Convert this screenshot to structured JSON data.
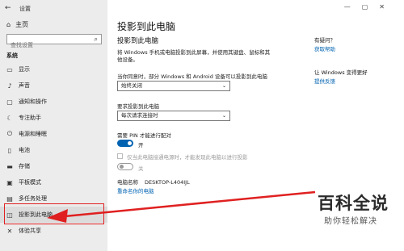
{
  "app": {
    "title": "设置"
  },
  "sidebar": {
    "home_label": "主页",
    "search_placeholder": "查找设置",
    "section_label": "系统",
    "items": [
      {
        "label": "显示",
        "icon": "monitor-icon"
      },
      {
        "label": "声音",
        "icon": "speaker-icon"
      },
      {
        "label": "通知和操作",
        "icon": "notification-icon"
      },
      {
        "label": "专注助手",
        "icon": "moon-icon"
      },
      {
        "label": "电源和睡眠",
        "icon": "power-icon"
      },
      {
        "label": "电池",
        "icon": "battery-icon"
      },
      {
        "label": "存储",
        "icon": "storage-icon"
      },
      {
        "label": "平板模式",
        "icon": "tablet-icon"
      },
      {
        "label": "多任务处理",
        "icon": "multitask-icon"
      },
      {
        "label": "投影到此电脑",
        "icon": "project-icon"
      },
      {
        "label": "体验共享",
        "icon": "share-icon"
      }
    ]
  },
  "main": {
    "page_title": "投影到此电脑",
    "subtitle": "投影到此电脑",
    "description": "将 Windows 手机或电脑投影到此屏幕，并使用其键盘、鼠标和其他设备。",
    "q1_label": "当你同意时，部分 Windows 和 Android 设备可以投影到此电脑",
    "q1_value": "始终关闭",
    "q2_label": "要求投影到此电脑",
    "q2_value": "每次请求连接时",
    "pin_label": "需要 PIN 才能进行配对",
    "pin_state": "开",
    "plug_label": "仅当此电脑接通电源时，才能发现此电脑以进行投影",
    "plug_state": "关",
    "pc_name_label": "电脑名称",
    "pc_name_value": "DESKTOP-L404IJL",
    "rename_label": "重命名你的电脑"
  },
  "help": {
    "q_heading": "有疑问？",
    "q_link": "获取帮助",
    "improve_heading": "让 Windows 变得更好",
    "improve_link": "提供反馈"
  },
  "watermark": {
    "line1": "百科全说",
    "line2": "助你轻松解决"
  },
  "colors": {
    "accent": "#0063b1",
    "highlight": "#e02020"
  }
}
